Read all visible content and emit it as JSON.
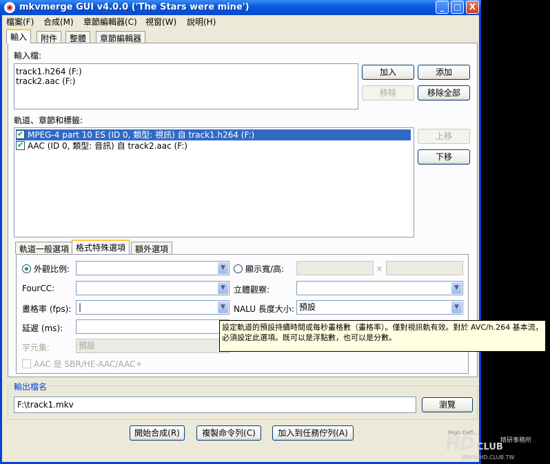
{
  "window": {
    "title": "mkvmerge GUI v4.0.0 ('The Stars were mine')"
  },
  "caption_buttons": {
    "minimize": "_",
    "maximize": "□",
    "close": "X"
  },
  "menubar": [
    "檔案(F)",
    "合成(M)",
    "章節編輯器(C)",
    "視窗(W)",
    "說明(H)"
  ],
  "tabs": [
    "輸入",
    "附件",
    "整體",
    "章節編輯器"
  ],
  "input": {
    "files_label": "輸入檔:",
    "files": [
      "track1.h264 (F:)",
      "track2.aac (F:)"
    ],
    "add": "加入",
    "append": "添加",
    "remove": "移除",
    "remove_all": "移除全部"
  },
  "tracks": {
    "label": "軌道、章節和標籤:",
    "rows": [
      {
        "checked": true,
        "text": "MPEG-4 part 10 ES (ID 0, 類型: 視訊) 自 track1.h264 (F:)"
      },
      {
        "checked": true,
        "text": "AAC (ID 0, 類型: 音訊) 自 track2.aac (F:)"
      }
    ],
    "check_mark": "✔",
    "move_up": "上移",
    "move_down": "下移"
  },
  "subtabs": [
    "軌道一般選項",
    "格式特殊選項",
    "額外選項"
  ],
  "format": {
    "aspect_label": "外觀比例:",
    "display_wh_label": "顯示寬/高:",
    "x_sep": "x",
    "fourcc_label": "FourCC:",
    "stereo_label": "立體觀察:",
    "fps_label": "畫格率 (fps):",
    "fps_value": "|",
    "nalu_label": "NALU 長度大小:",
    "nalu_value": "預設",
    "delay_label": "延遲 (ms):",
    "charset_label": "字元集:",
    "charset_value": "預設",
    "aac_label": "AAC 是 SBR/HE-AAC/AAC+",
    "arrow": "▼"
  },
  "tooltip": "設定軌道的預設持續時間或每秒畫格數（畫格率）。僅對視訊軌有效。對於 AVC/h.264 基本流，必須設定此選項。既可以是浮點數，也可以是分數。",
  "output": {
    "legend": "輸出檔名",
    "path": "F:\\track1.mkv",
    "browse": "瀏覽"
  },
  "actions": {
    "start": "開始合成(R)",
    "copy_cmd": "複製命令列(C)",
    "add_job": "加入到任務佇列(A)"
  },
  "watermark": {
    "tagline": "High Defi...",
    "brand": "HD",
    "club": "CLUB",
    "cn": "精研事務所",
    "url": "WWW.HD.CLUB.TW"
  },
  "colors": {
    "titlebar": "#0a5ae0",
    "selection": "#316ac5",
    "face": "#ece9d8",
    "tooltip": "#ffffe1",
    "accent_tab": "#ffc73c"
  }
}
